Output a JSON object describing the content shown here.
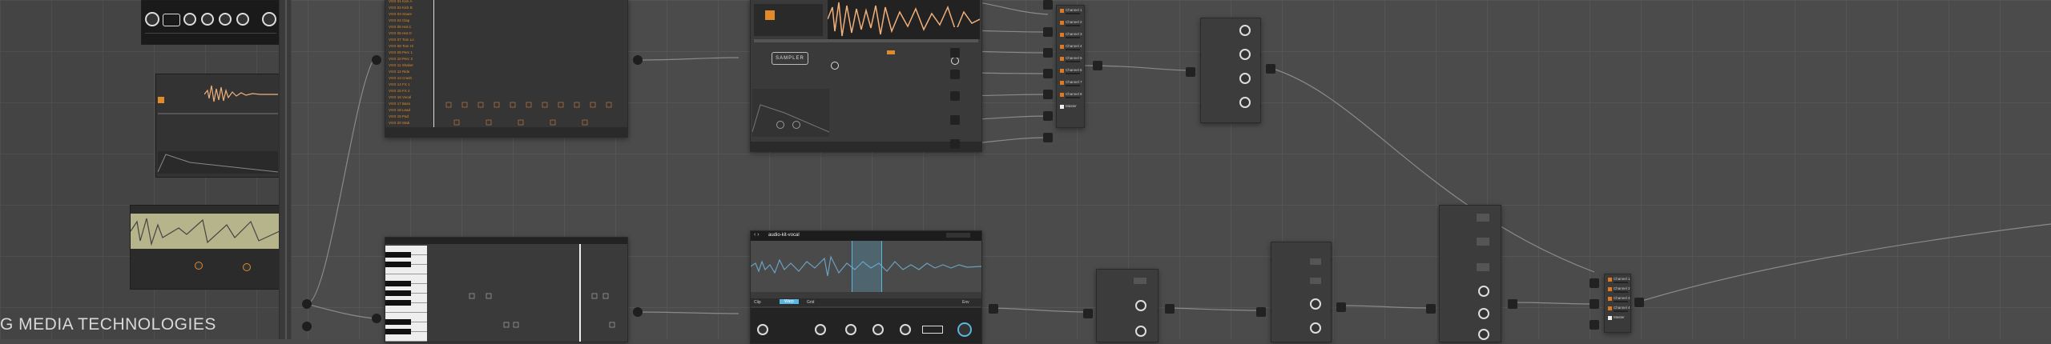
{
  "brand_text": "G MEDIA TECHNOLOGIES",
  "sampler": {
    "logo": "SAMPLER",
    "tab1": "Inst",
    "tab2": "Params"
  },
  "audio_clip": {
    "title": "audio-kit-vocal",
    "tab_active": "Warp",
    "tabs": [
      "Clip",
      "Warp",
      "Grid",
      "Env"
    ]
  },
  "browser_list": {
    "items": [
      "VOX 01 Kick A",
      "VOX 02 Kick B",
      "VOX 03 Snare",
      "VOX 04 Clap",
      "VOX 05 Hat C",
      "VOX 06 Hat O",
      "VOX 07 Tom Lo",
      "VOX 08 Tom Hi",
      "VOX 09 Perc 1",
      "VOX 10 Perc 2",
      "VOX 11 Shaker",
      "VOX 12 Ride",
      "VOX 13 Crash",
      "VOX 14 FX 1",
      "VOX 15 FX 2",
      "VOX 16 Vocal",
      "VOX 17 Bass",
      "VOX 18 Lead",
      "VOX 19 Pad",
      "VOX 20 Stab"
    ]
  },
  "mixer_top": {
    "channels": [
      "Channel 1",
      "Channel 2",
      "Channel 3",
      "Channel 4",
      "Channel 5",
      "Channel 6",
      "Channel 7",
      "Channel 8"
    ],
    "master": "Master"
  },
  "mixer_bottom": {
    "channels": [
      "Channel 1",
      "Channel 2",
      "Channel 3",
      "Channel 4"
    ],
    "master": "Master"
  },
  "colors": {
    "accent": "#e08a2a",
    "clip_blue": "#5ab6e0",
    "canvas": "#4b4b4b"
  }
}
